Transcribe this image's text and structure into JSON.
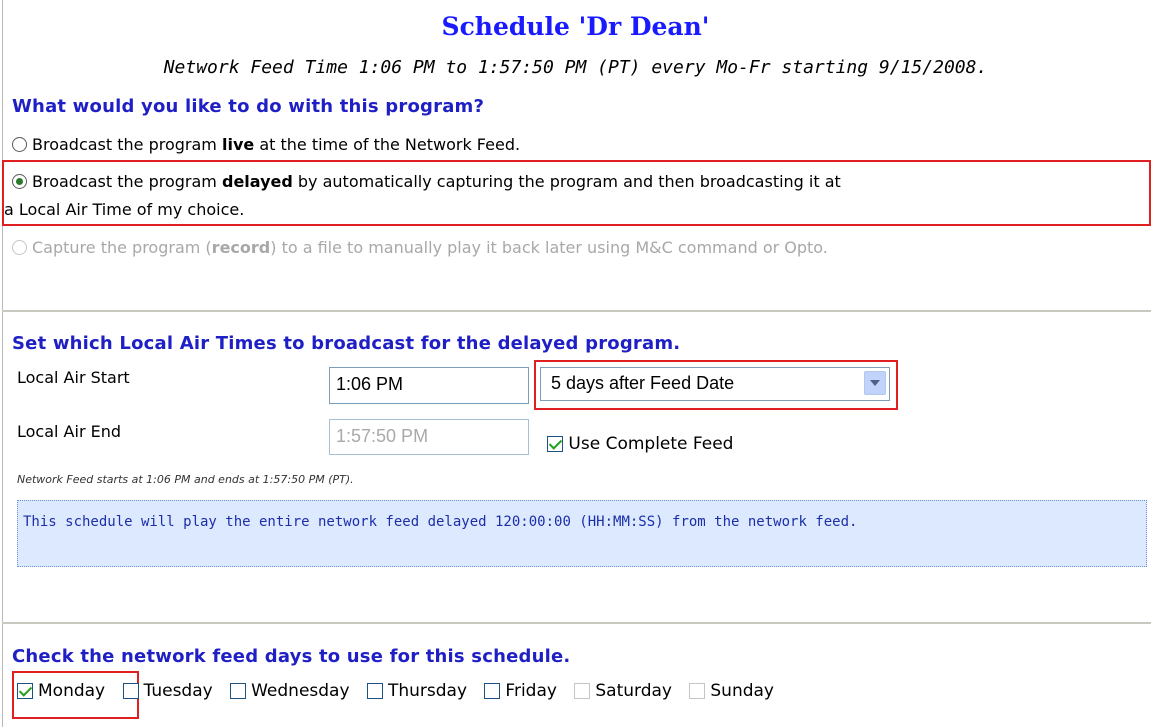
{
  "title": "Schedule 'Dr Dean'",
  "subtitle": "Network Feed Time 1:06 PM to 1:57:50 PM (PT) every Mo-Fr starting 9/15/2008.",
  "program_question": "What would you like to do with this program?",
  "options": {
    "live": {
      "pre": "Broadcast the program ",
      "bold": "live",
      "post": " at the time of the Network Feed."
    },
    "delayed": {
      "pre": "Broadcast the program ",
      "bold": "delayed",
      "post": " by automatically capturing the program and then broadcasting it at",
      "line2": "a Local Air Time of my choice."
    },
    "record": {
      "pre": "Capture the program (",
      "bold": "record",
      "post": ") to a file to manually play it back later using M&C command or Opto."
    }
  },
  "air_times_heading": "Set which Local Air Times to broadcast for the delayed program.",
  "local_air_start": {
    "label": "Local Air Start",
    "value": "1:06 PM"
  },
  "delay_select": {
    "value": "5 days after Feed Date"
  },
  "local_air_end": {
    "label": "Local Air End",
    "value": "1:57:50 PM"
  },
  "use_complete_feed": {
    "label": "Use Complete Feed",
    "checked": true
  },
  "feed_note": "Network Feed starts at 1:06 PM and ends at 1:57:50 PM (PT).",
  "info_text": "This schedule will play the entire network feed delayed 120:00:00 (HH:MM:SS) from the network feed.",
  "days_heading": "Check the network feed days to use for this schedule.",
  "days": [
    {
      "label": "Monday",
      "checked": true,
      "enabled": true
    },
    {
      "label": "Tuesday",
      "checked": false,
      "enabled": true
    },
    {
      "label": "Wednesday",
      "checked": false,
      "enabled": true
    },
    {
      "label": "Thursday",
      "checked": false,
      "enabled": true
    },
    {
      "label": "Friday",
      "checked": false,
      "enabled": true
    },
    {
      "label": "Saturday",
      "checked": false,
      "enabled": false
    },
    {
      "label": "Sunday",
      "checked": false,
      "enabled": false
    }
  ]
}
